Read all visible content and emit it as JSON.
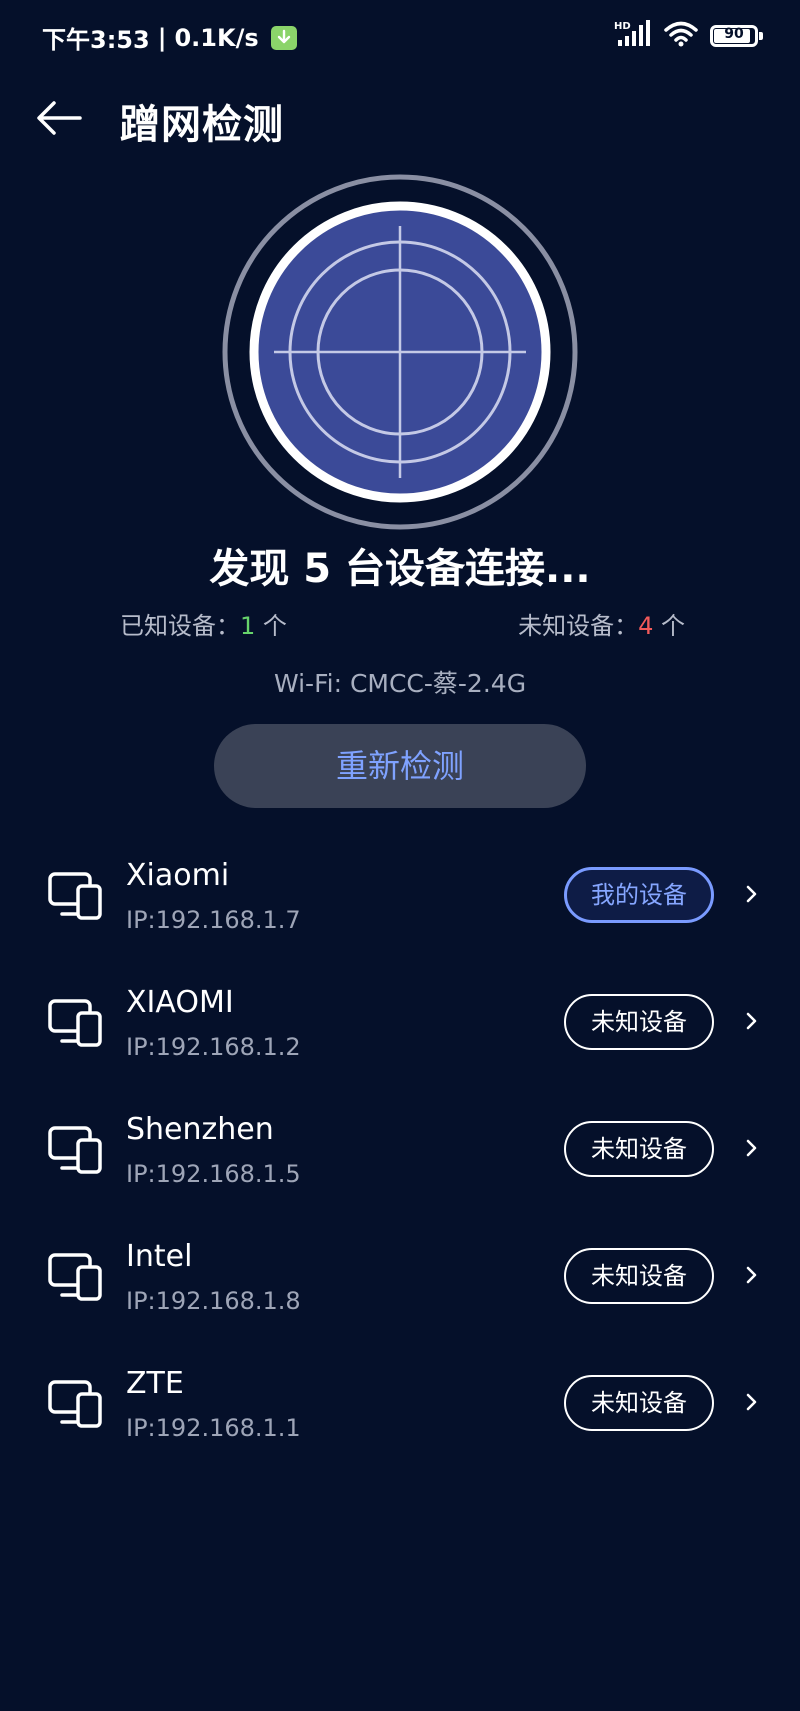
{
  "status_bar": {
    "time": "下午3:53",
    "separator": "|",
    "speed": "0.1K/s",
    "network_type": "HD",
    "battery_level": "90",
    "icons": [
      "download-badge-icon",
      "signal-icon",
      "wifi-icon",
      "battery-icon"
    ]
  },
  "header": {
    "title": "蹭网检测",
    "back_icon": "arrow-left-icon"
  },
  "scan": {
    "found_text": "发现 5 台设备连接...",
    "known_label": "已知设备：",
    "known_count": "1",
    "unknown_label": "未知设备：",
    "unknown_count": "4",
    "unit": "个",
    "wifi_text": "Wi-Fi: CMCC-蔡-2.4G",
    "recheck_label": "重新检测"
  },
  "devices": [
    {
      "name": "Xiaomi",
      "ip": "IP:192.168.1.7",
      "tag": "我的设备",
      "mine": true
    },
    {
      "name": "XIAOMI",
      "ip": "IP:192.168.1.2",
      "tag": "未知设备",
      "mine": false
    },
    {
      "name": "Shenzhen",
      "ip": "IP:192.168.1.5",
      "tag": "未知设备",
      "mine": false
    },
    {
      "name": "Intel",
      "ip": "IP:192.168.1.8",
      "tag": "未知设备",
      "mine": false
    },
    {
      "name": "ZTE",
      "ip": "IP:192.168.1.1",
      "tag": "未知设备",
      "mine": false
    }
  ],
  "colors": {
    "background": "#05102a",
    "radar_fill": "#3b4a98",
    "known_count": "#67d36b",
    "unknown_count": "#f35a5a",
    "accent": "#7fa2ff"
  }
}
